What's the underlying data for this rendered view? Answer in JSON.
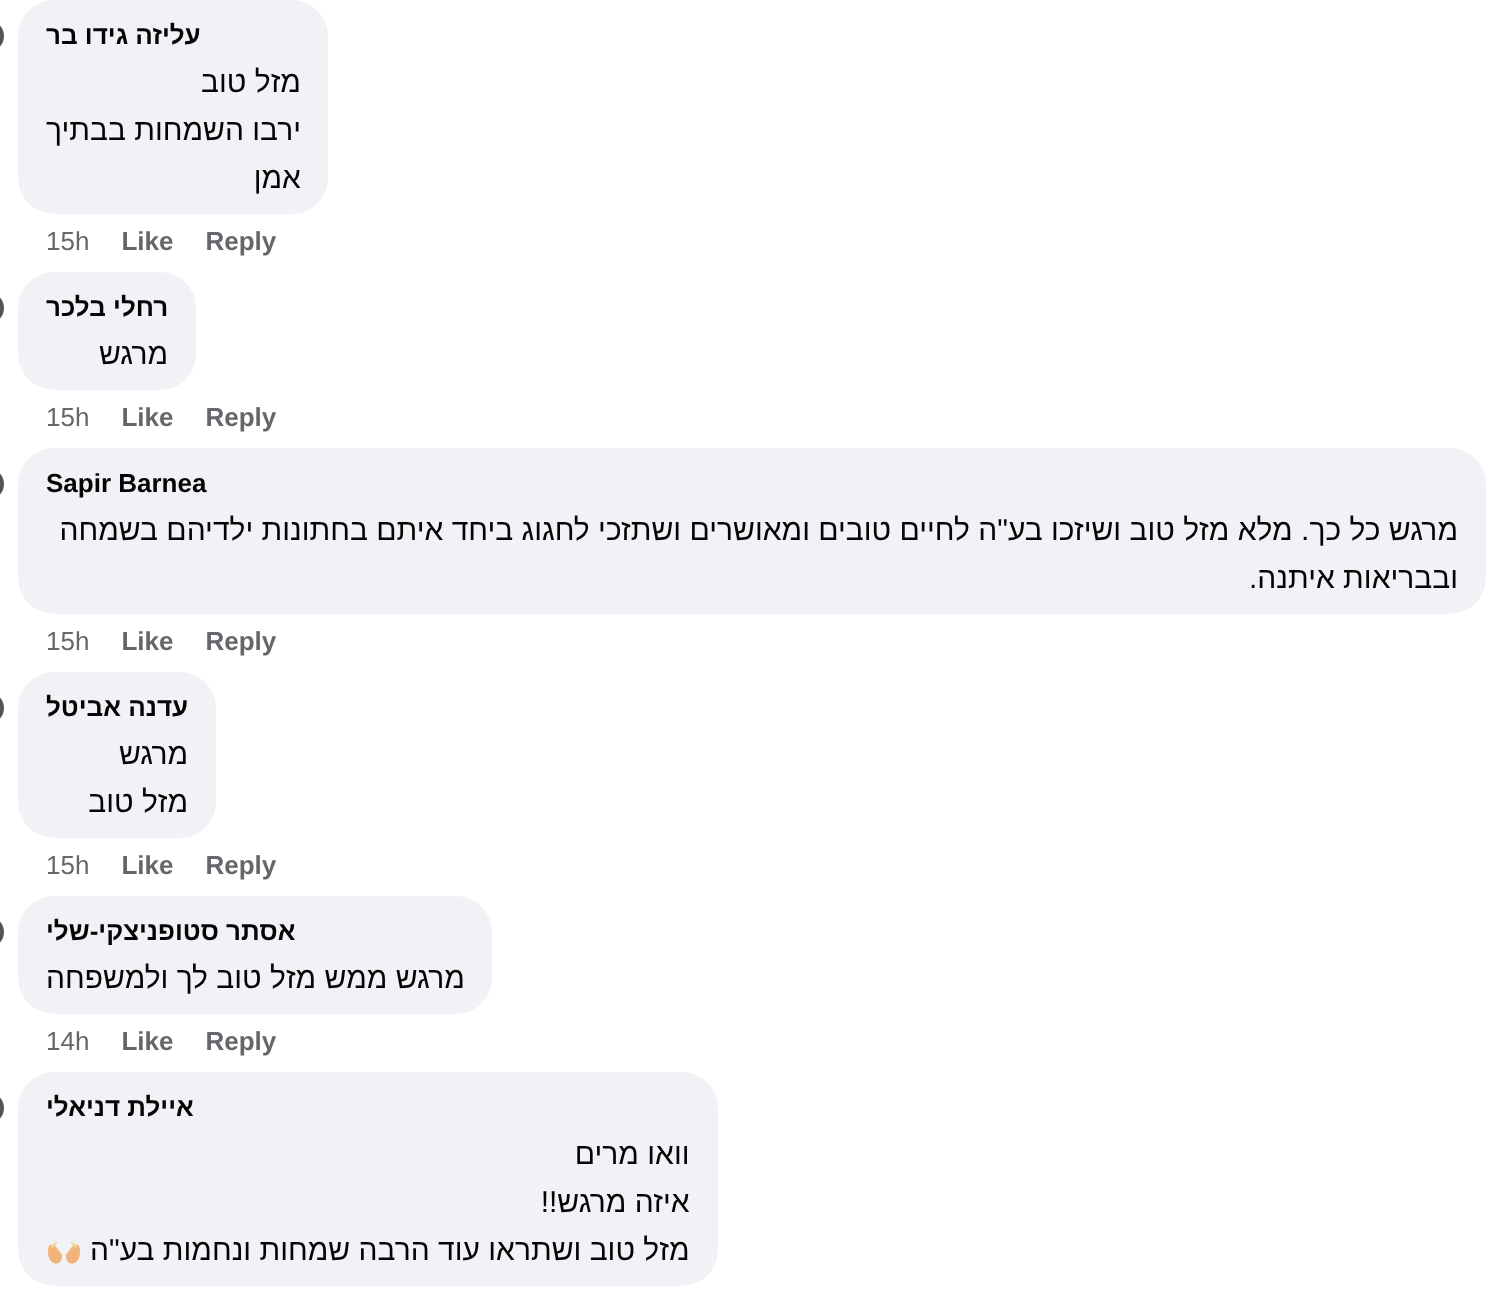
{
  "comments": [
    {
      "author": "עליזה גידו בר",
      "lines": [
        {
          "text": "מזל טוב"
        },
        {
          "text": "ירבו השמחות בבתיך"
        },
        {
          "text": "אמן"
        }
      ],
      "time": "15h",
      "like": "Like",
      "reply": "Reply"
    },
    {
      "author": "רחלי בלכר",
      "lines": [
        {
          "text": "מרגש"
        }
      ],
      "time": "15h",
      "like": "Like",
      "reply": "Reply"
    },
    {
      "author": "Sapir Barnea",
      "lines": [
        {
          "text": "מרגש כל כך. מלא מזל טוב ושיזכו בע\"ה לחיים טובים ומאושרים ושתזכי לחגוג ביחד איתם בחתונות ילדיהם בשמחה ובבריאות איתנה."
        }
      ],
      "time": "15h",
      "like": "Like",
      "reply": "Reply"
    },
    {
      "author": "עדנה אביטל",
      "lines": [
        {
          "text": "מרגש"
        },
        {
          "text": "מזל טוב"
        }
      ],
      "time": "15h",
      "like": "Like",
      "reply": "Reply"
    },
    {
      "author": "אסתר סטופניצקי-שלי",
      "lines": [
        {
          "text": "מרגש ממש מזל טוב לך ולמשפחה"
        }
      ],
      "time": "14h",
      "like": "Like",
      "reply": "Reply"
    },
    {
      "author": "איילת דניאלי",
      "lines": [
        {
          "text": "וואו מרים"
        },
        {
          "text": "איזה מרגש!!"
        },
        {
          "text": "מזל טוב ושתראו עוד הרבה שמחות ונחמות בע\"ה",
          "emoji": true
        }
      ]
    }
  ]
}
